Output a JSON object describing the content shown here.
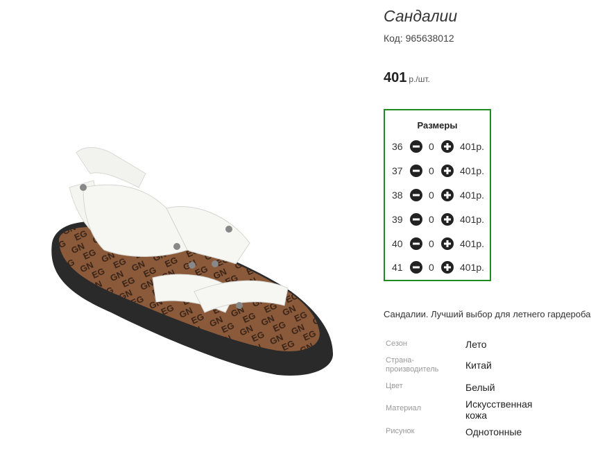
{
  "product": {
    "title": "Сандалии",
    "code": "Код: 965638012",
    "price_value": "401",
    "price_unit": "р./шт.",
    "image_alt": "white-sandal-photo"
  },
  "sizes": {
    "title": "Размеры",
    "rows": [
      {
        "size": "36",
        "qty": "0",
        "price": "401р."
      },
      {
        "size": "37",
        "qty": "0",
        "price": "401р."
      },
      {
        "size": "38",
        "qty": "0",
        "price": "401р."
      },
      {
        "size": "39",
        "qty": "0",
        "price": "401р."
      },
      {
        "size": "40",
        "qty": "0",
        "price": "401р."
      },
      {
        "size": "41",
        "qty": "0",
        "price": "401р."
      }
    ],
    "minus_icon": "minus-circle-icon",
    "plus_icon": "plus-circle-icon",
    "border_color": "#1e8b1e"
  },
  "description": "Сандалии. Лучший выбор для летнего гардероба",
  "attributes": [
    {
      "label_line1": "Сезон",
      "label_line2": "",
      "value_line1": "Лето",
      "value_line2": ""
    },
    {
      "label_line1": "Страна-",
      "label_line2": "производитель",
      "value_line1": "Китай",
      "value_line2": ""
    },
    {
      "label_line1": "Цвет",
      "label_line2": "",
      "value_line1": "Белый",
      "value_line2": ""
    },
    {
      "label_line1": "Материал",
      "label_line2": "",
      "value_line1": "Искусственная",
      "value_line2": "кожа"
    },
    {
      "label_line1": "Рисунок",
      "label_line2": "",
      "value_line1": "Однотонные",
      "value_line2": ""
    }
  ]
}
